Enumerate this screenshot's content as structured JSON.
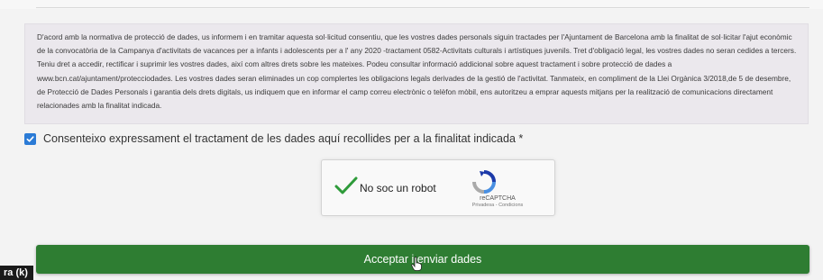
{
  "privacy_notice": {
    "text": "D'acord amb la normativa de protecció de dades, us informem i en tramitar aquesta sol·licitud consentiu, que les vostres dades personals siguin tractades per l'Ajuntament de Barcelona amb la finalitat de sol·licitar l'ajut econòmic de la convocatòria de la Campanya d'activitats de vacances per a infants i adolescents per a l' any 2020 -tractament 0582-Activitats culturals i artístiques juvenils. Tret d'obligació legal, les vostres dades no seran cedides a tercers. Teniu dret a accedir, rectificar i suprimir les vostres dades, així com altres drets sobre les mateixes. Podeu consultar informació addicional sobre aquest tractament i sobre protecció de dades a www.bcn.cat/ajuntament/protecciodades. Les vostres dades seran eliminades un cop complertes les obligacions legals derivades de la gestió de l'activitat. Tanmateix, en compliment de la Llei Orgànica 3/2018,de 5 de desembre, de Protecció de Dades Personals i garantia dels drets digitals, us indiquem que en informar el camp correu electrònic o telèfon mòbil, ens autoritzeu a emprar aquests mitjans per la realització de comunicacions directament relacionades amb la finalitat indicada."
  },
  "consent": {
    "label": "Consenteixo expressament el tractament de les dades aquí recollides per a la finalitat indicada *",
    "checked": true
  },
  "captcha": {
    "label": "No soc un robot",
    "brand": "reCAPTCHA",
    "links": "Privadesa - Condicions"
  },
  "submit": {
    "label": "Acceptar i enviar dades"
  },
  "corner": {
    "text": "ra (k)"
  },
  "colors": {
    "accent_green": "#2e7d32",
    "checkbox_blue": "#2b7bd6",
    "notice_bg": "#ebe8ed"
  }
}
